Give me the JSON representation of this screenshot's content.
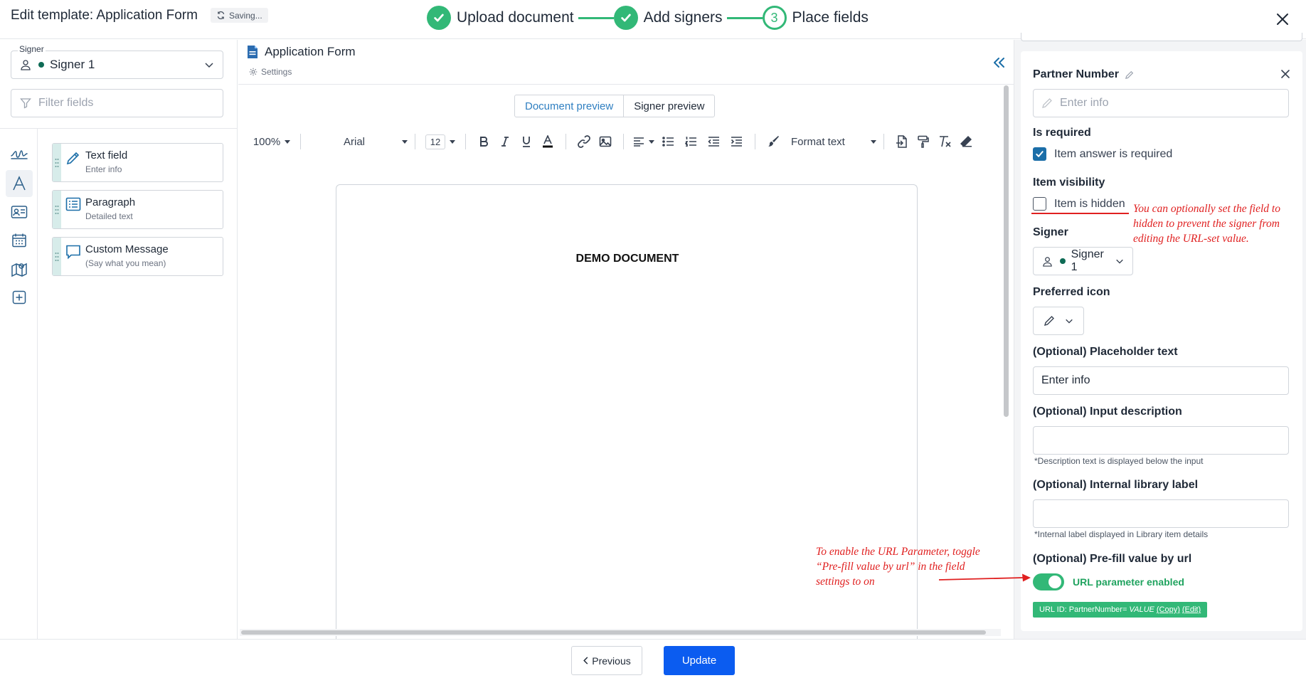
{
  "header": {
    "title": "Edit template: Application Form",
    "saving_label": "Saving...",
    "steps": [
      {
        "label": "Upload document",
        "state": "done"
      },
      {
        "label": "Add signers",
        "state": "done"
      },
      {
        "label": "Place fields",
        "number": "3",
        "state": "current"
      }
    ]
  },
  "left_panel": {
    "signer_label": "Signer",
    "signer_value": "Signer 1",
    "filter_placeholder": "Filter fields",
    "rail_icons": [
      "signature-icon",
      "text-icon",
      "contact-card-icon",
      "calendar-icon",
      "map-icon",
      "add-icon"
    ],
    "fields": [
      {
        "name": "Text field",
        "description": "Enter info",
        "icon": "pencil-icon"
      },
      {
        "name": "Paragraph",
        "description": "Detailed text",
        "icon": "paragraph-icon"
      },
      {
        "name": "Custom Message",
        "description": "(Say what you mean)",
        "icon": "speech-bubble-icon"
      }
    ]
  },
  "editor": {
    "form_title": "Application Form",
    "settings_label": "Settings",
    "preview_tabs": {
      "document": "Document preview",
      "signer": "Signer preview"
    },
    "toolbar": {
      "zoom": "100%",
      "font": "Arial",
      "font_size": "12",
      "format_label": "Format text"
    },
    "document_heading": "DEMO DOCUMENT"
  },
  "settings_panel": {
    "field_title": "Partner Number",
    "info_placeholder": "Enter info",
    "required_heading": "Is required",
    "required_label": "Item answer is required",
    "required_checked": true,
    "visibility_heading": "Item visibility",
    "hidden_label": "Item is hidden",
    "hidden_checked": false,
    "signer_heading": "Signer",
    "signer_value": "Signer 1",
    "icon_heading": "Preferred icon",
    "placeholder_heading": "(Optional) Placeholder text",
    "placeholder_value": "Enter info",
    "input_desc_heading": "(Optional) Input description",
    "input_desc_value": "",
    "input_desc_note": "*Description text is displayed below the input",
    "library_heading": "(Optional) Internal library label",
    "library_value": "",
    "library_note": "*Internal label displayed in Library item details",
    "prefill_heading": "(Optional) Pre-fill value by url",
    "toggle_label": "URL parameter enabled",
    "toggle_on": true,
    "url_badge": {
      "prefix": "URL ID: PartnerNumber=",
      "value": "VALUE",
      "copy": "(Copy)",
      "edit": "(Edit)"
    }
  },
  "annotations": {
    "hidden_note": [
      "You can optionally set the field to",
      "hidden to prevent the signer from",
      "editing the URL-set value."
    ],
    "url_note": [
      "To enable the URL Parameter, toggle",
      "“Pre-fill value by url” in the field",
      "settings to on"
    ]
  },
  "footer": {
    "previous_label": "Previous",
    "update_label": "Update"
  },
  "colors": {
    "accent_green": "#32b877",
    "primary_blue": "#0b5cf0",
    "annotation_red": "#e02020"
  }
}
